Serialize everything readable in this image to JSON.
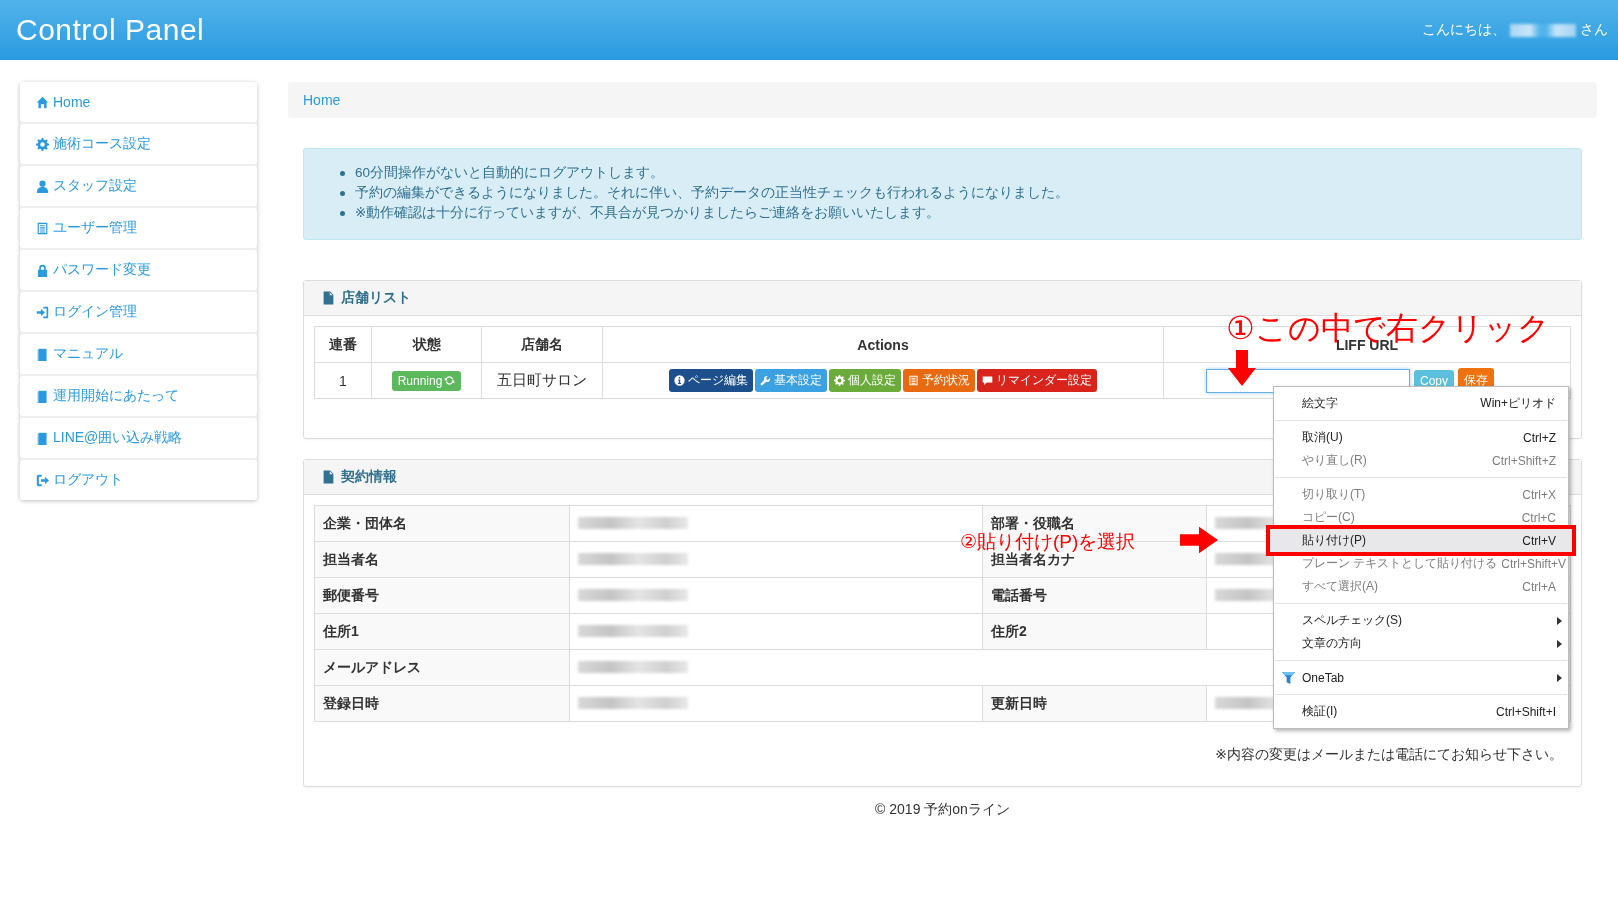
{
  "header": {
    "title": "Control Panel",
    "greeting_prefix": "こんにちは、",
    "name_redacted": true,
    "greeting_suffix": "さん"
  },
  "sidebar": {
    "items": [
      {
        "label": "Home"
      },
      {
        "label": "施術コース設定"
      },
      {
        "label": "スタッフ設定"
      },
      {
        "label": "ユーザー管理"
      },
      {
        "label": "パスワード変更"
      },
      {
        "label": "ログイン管理"
      },
      {
        "label": "マニュアル"
      },
      {
        "label": "運用開始にあたって"
      },
      {
        "label": "LINE@囲い込み戦略"
      },
      {
        "label": "ログアウト"
      }
    ]
  },
  "breadcrumb": [
    "Home"
  ],
  "notices": [
    "60分間操作がないと自動的にログアウトします。",
    "予約の編集ができるようになりました。それに伴い、予約データの正当性チェックも行われるようになりました。",
    "※動作確認は十分に行っていますが、不具合が見つかりましたらご連絡をお願いいたします。"
  ],
  "store_panel": {
    "title": "店舗リスト",
    "columns": [
      "連番",
      "状態",
      "店舗名",
      "Actions",
      "LIFF URL"
    ],
    "rows": [
      {
        "number": "1",
        "status": "Running",
        "store": "五日町サロン",
        "actions": [
          {
            "label": "ページ編集",
            "color": "#1c4f8c"
          },
          {
            "label": "基本設定",
            "color": "#3ba1e0"
          },
          {
            "label": "個人設定",
            "color": "#6aab3c"
          },
          {
            "label": "予約状況",
            "color": "#e8690f"
          },
          {
            "label": "リマインダー設定",
            "color": "#d9241c"
          }
        ],
        "liff_buttons": [
          {
            "label": "Copy",
            "color": "#5bc0de"
          },
          {
            "label": "保存",
            "color": "#f0720e"
          }
        ]
      }
    ]
  },
  "contract_panel": {
    "title": "契約情報",
    "rows": [
      {
        "cells": [
          {
            "label": "企業・団体名",
            "redacted": true
          },
          {
            "label": "部署・役職名",
            "redacted": true
          }
        ]
      },
      {
        "cells": [
          {
            "label": "担当者名",
            "redacted": true
          },
          {
            "label": "担当者名カナ",
            "redacted": true
          }
        ]
      },
      {
        "cells": [
          {
            "label": "郵便番号",
            "redacted": true
          },
          {
            "label": "電話番号",
            "redacted": true
          }
        ]
      },
      {
        "cells": [
          {
            "label": "住所1",
            "redacted": true
          },
          {
            "label": "住所2",
            "redacted": false
          }
        ]
      },
      {
        "cells": [
          {
            "label": "メールアドレス",
            "redacted": true
          }
        ]
      },
      {
        "cells": [
          {
            "label": "登録日時",
            "redacted": true
          },
          {
            "label": "更新日時",
            "redacted": true
          }
        ]
      }
    ],
    "note": "※内容の変更はメールまたは電話にてお知らせ下さい。"
  },
  "footer": "© 2019 予約onライン",
  "context_menu": {
    "items": [
      {
        "kind": "item",
        "label": "絵文字",
        "shortcut": "Win+ピリオド",
        "disabled": false,
        "selected": false,
        "marked": false
      },
      {
        "kind": "separator"
      },
      {
        "kind": "item",
        "label": "取消(U)",
        "shortcut": "Ctrl+Z",
        "disabled": false,
        "selected": false,
        "marked": false
      },
      {
        "kind": "item",
        "label": "やり直し(R)",
        "shortcut": "Ctrl+Shift+Z",
        "disabled": true,
        "selected": false,
        "marked": false
      },
      {
        "kind": "separator"
      },
      {
        "kind": "item",
        "label": "切り取り(T)",
        "shortcut": "Ctrl+X",
        "disabled": true,
        "selected": false,
        "marked": false
      },
      {
        "kind": "item",
        "label": "コピー(C)",
        "shortcut": "Ctrl+C",
        "disabled": true,
        "selected": false,
        "marked": false
      },
      {
        "kind": "item",
        "label": "貼り付け(P)",
        "shortcut": "Ctrl+V",
        "disabled": false,
        "selected": true,
        "marked": true
      },
      {
        "kind": "item",
        "label": "プレーン テキストとして貼り付ける",
        "shortcut": "Ctrl+Shift+V",
        "disabled": true,
        "selected": false,
        "marked": false
      },
      {
        "kind": "item",
        "label": "すべて選択(A)",
        "shortcut": "Ctrl+A",
        "disabled": true,
        "selected": false,
        "marked": false
      },
      {
        "kind": "separator"
      },
      {
        "kind": "submenu",
        "label": "スペルチェック(S)",
        "disabled": false,
        "selected": false,
        "marked": false
      },
      {
        "kind": "submenu",
        "label": "文章の方向",
        "disabled": false,
        "selected": false,
        "marked": false
      },
      {
        "kind": "separator"
      },
      {
        "kind": "submenu",
        "label": "OneTab",
        "disabled": false,
        "selected": false,
        "marked": false
      },
      {
        "kind": "separator"
      },
      {
        "kind": "item",
        "label": "検証(I)",
        "shortcut": "Ctrl+Shift+I",
        "disabled": false,
        "selected": false,
        "marked": false
      }
    ]
  },
  "annotations": [
    {
      "kind": "arrow_down",
      "text": "①この中で右クリック"
    },
    {
      "kind": "arrow_right",
      "text": "②貼り付け(P)を選択"
    }
  ]
}
